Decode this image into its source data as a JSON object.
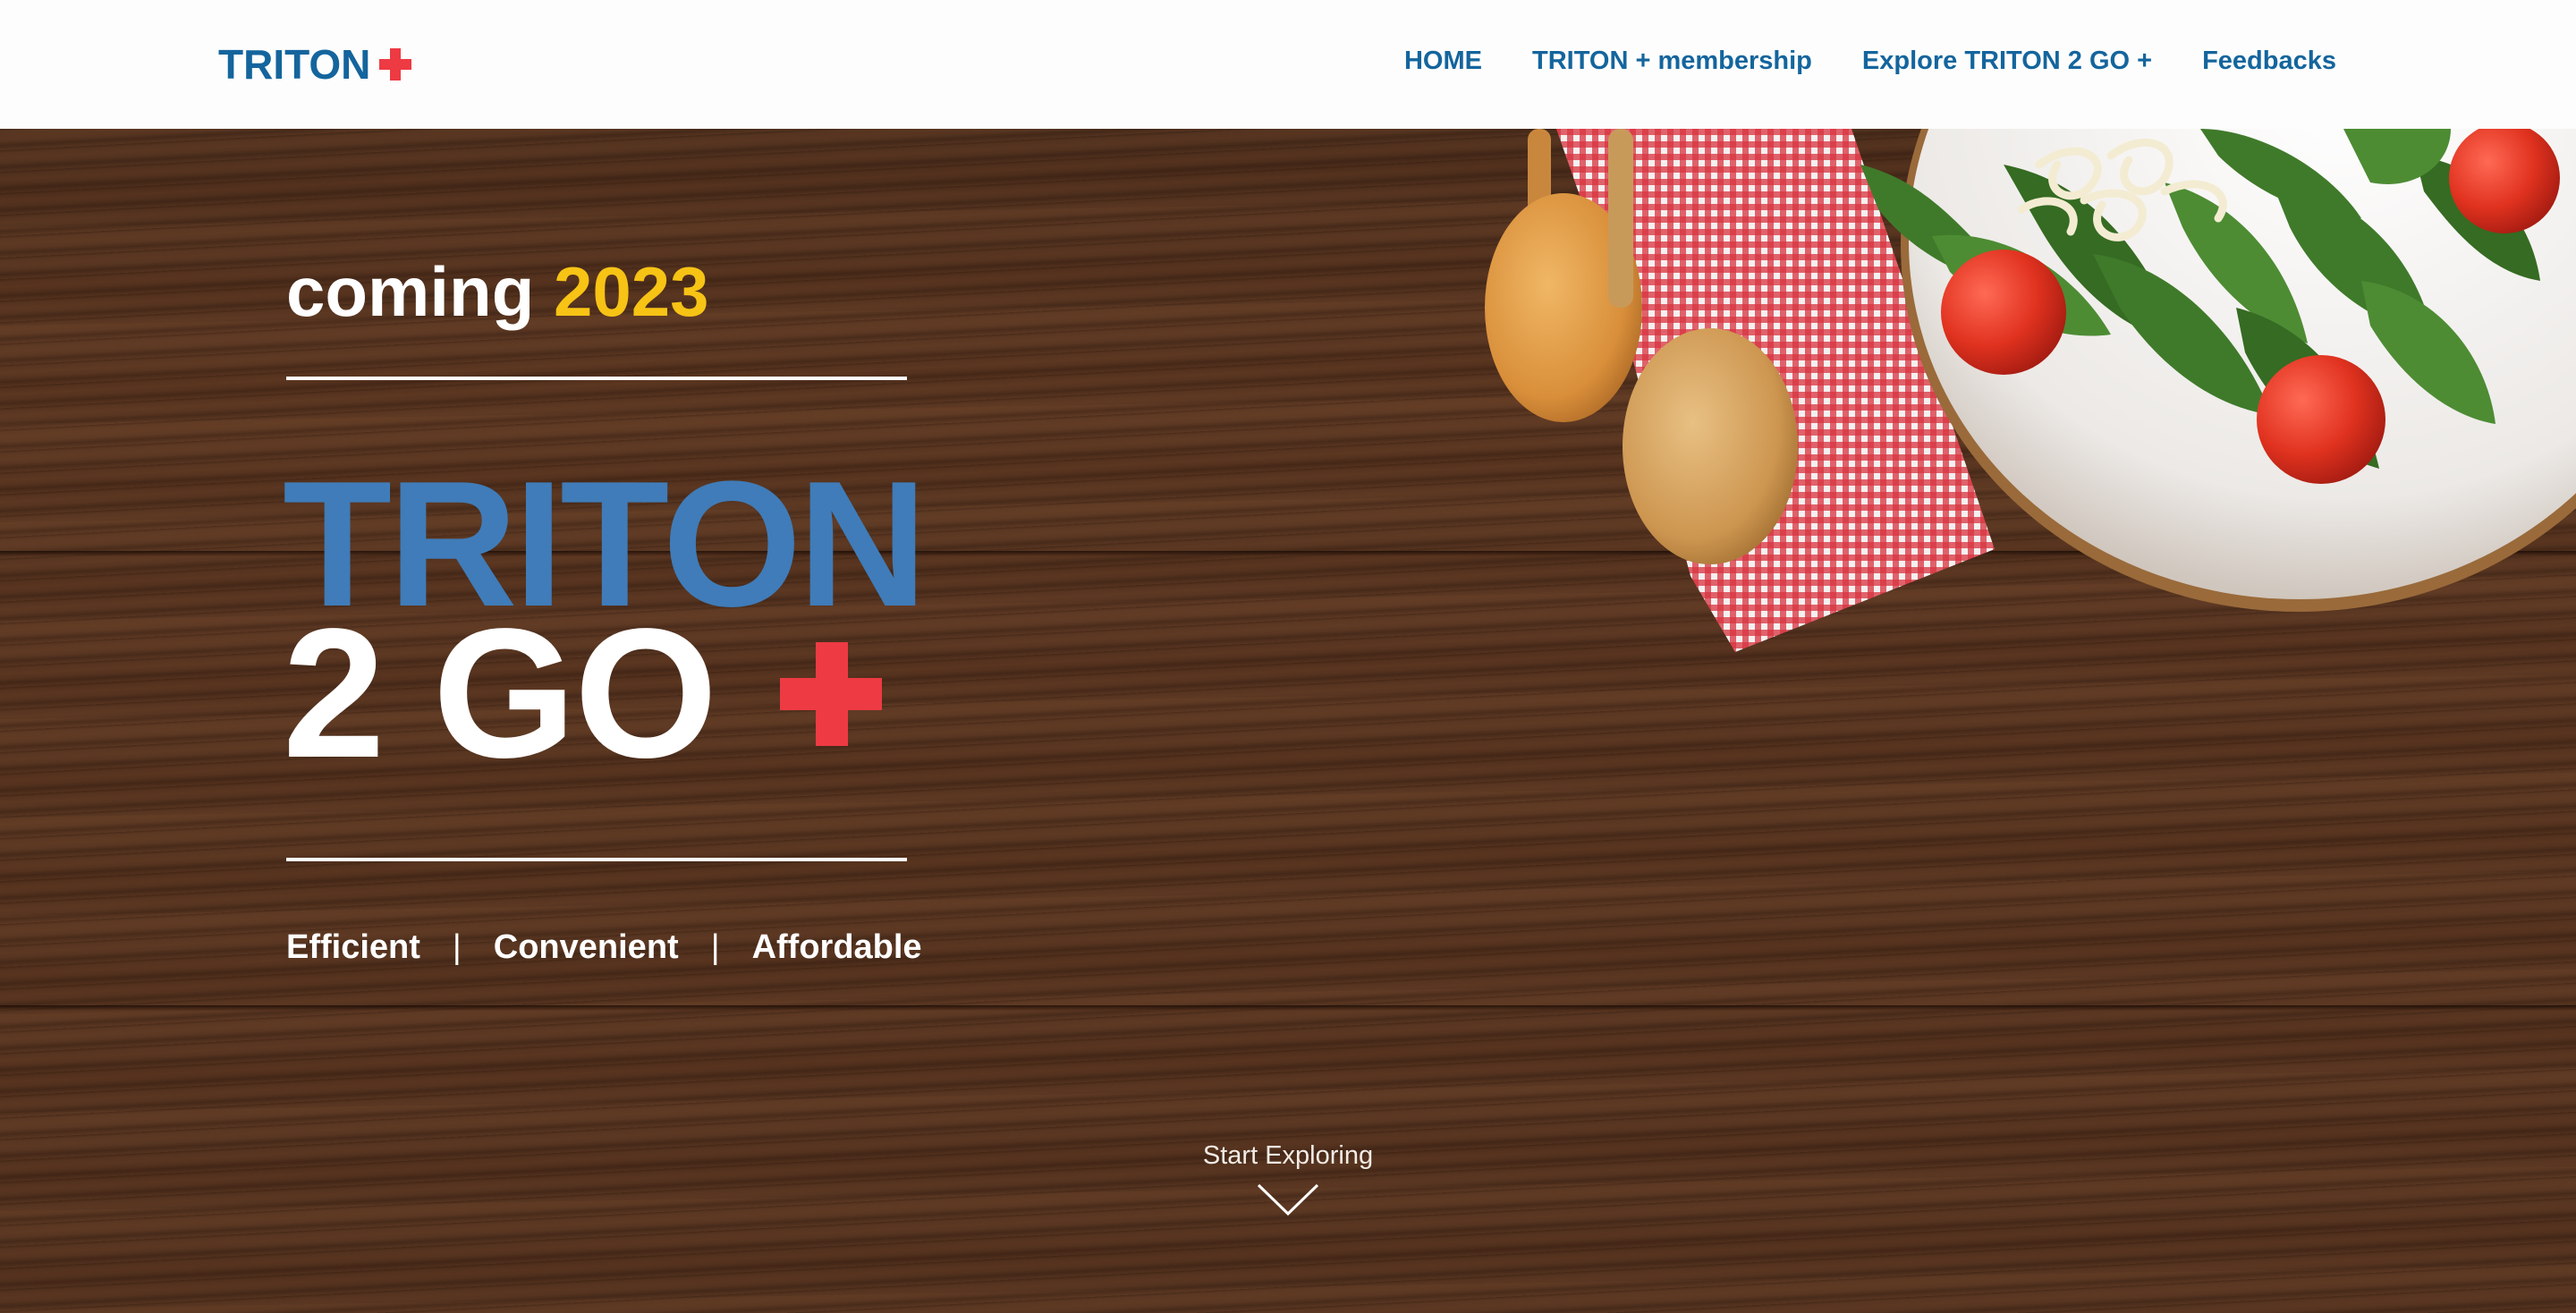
{
  "header": {
    "logo": {
      "text": "TRITON",
      "accent_color": "#ee3a43",
      "brand_color": "#14659d"
    },
    "nav": [
      {
        "label": "HOME"
      },
      {
        "label": "TRITON + membership"
      },
      {
        "label": "Explore TRITON 2 GO +"
      },
      {
        "label": "Feedbacks"
      }
    ]
  },
  "hero": {
    "coming_text": "coming",
    "coming_year": "2023",
    "year_color": "#f7c315",
    "title_line1": "TRITON",
    "title_line2": "2 GO",
    "title_line1_color": "#3f7cb9",
    "plus_color": "#ee3a43",
    "taglines": [
      "Efficient",
      "Convenient",
      "Affordable"
    ],
    "tagline_separator": "|",
    "explore_label": "Start Exploring",
    "explore_icon": "chevron-down-icon",
    "background": "wooden-table-photo"
  }
}
